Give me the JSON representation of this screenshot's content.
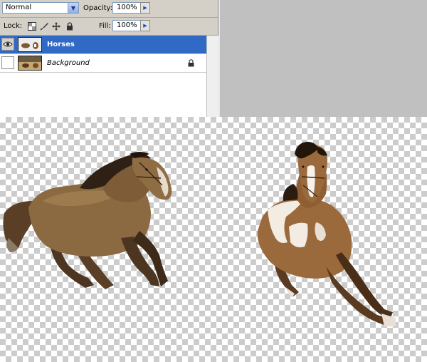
{
  "layers_panel": {
    "blend_mode": "Normal",
    "opacity_label": "Opacity:",
    "opacity_value": "100%",
    "lock_label": "Lock:",
    "fill_label": "Fill:",
    "fill_value": "100%",
    "layers": [
      {
        "name": "Horses",
        "visible": true,
        "selected": true,
        "locked": false
      },
      {
        "name": "Background",
        "visible": false,
        "selected": false,
        "locked": true
      }
    ]
  },
  "colors": {
    "selection": "#316ac5",
    "panel": "#d4d0c8"
  },
  "canvas": {
    "content": "two running horses on transparent background",
    "transparency_pattern": "checkerboard"
  }
}
